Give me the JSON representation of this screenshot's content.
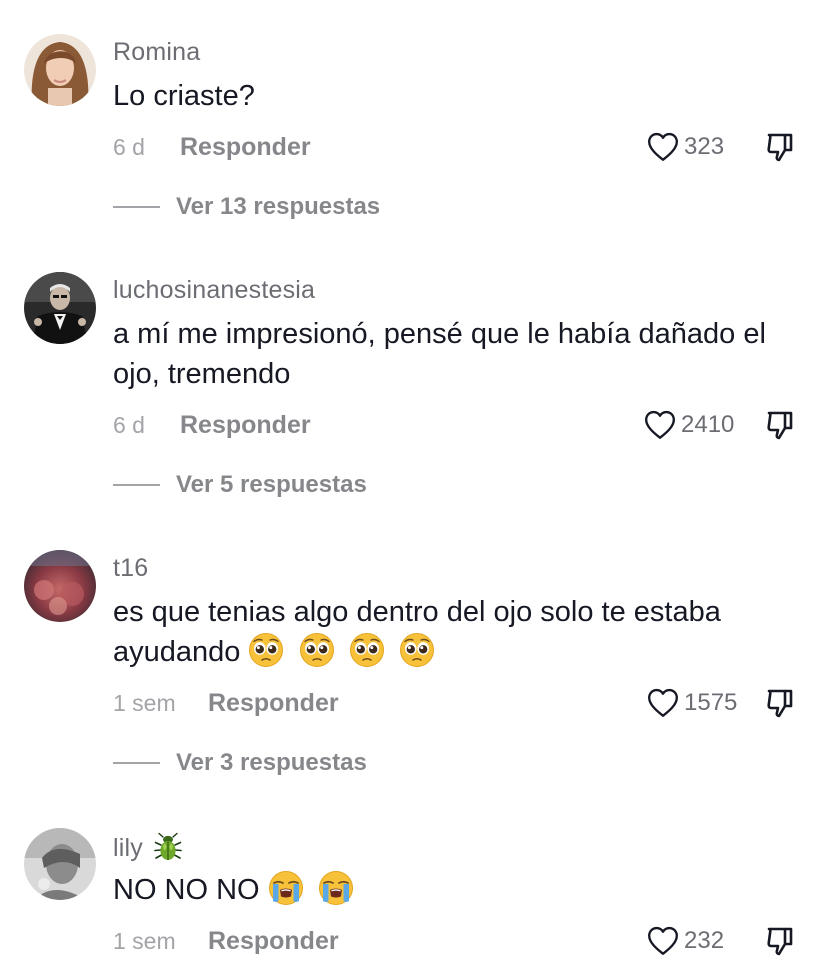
{
  "comments": [
    {
      "username": "Romina",
      "text": "Lo criaste?",
      "timestamp": "6 d",
      "reply_label": "Responder",
      "likes": "323",
      "replies_label": "Ver 13 respuestas"
    },
    {
      "username": "luchosinanestesia",
      "text": "a mí me impresionó, pensé que le había dañado el ojo, tremendo",
      "timestamp": "6 d",
      "reply_label": "Responder",
      "likes": "2410",
      "replies_label": "Ver 5 respuestas"
    },
    {
      "username": "t16",
      "text": "es que tenias algo dentro del ojo solo te estaba ayudando",
      "emojis": [
        "pleading-face",
        "pleading-face",
        "pleading-face",
        "pleading-face"
      ],
      "timestamp": "1 sem",
      "reply_label": "Responder",
      "likes": "1575",
      "replies_label": "Ver 3 respuestas"
    },
    {
      "username": "lily",
      "username_emoji": "beetle",
      "text": "NO NO NO",
      "emojis": [
        "loudly-crying-face",
        "loudly-crying-face"
      ],
      "timestamp": "1 sem",
      "reply_label": "Responder",
      "likes": "232"
    }
  ],
  "icons": {
    "like": "heart-outline-icon",
    "dislike": "thumbs-down-icon"
  },
  "colors": {
    "text": "#161823",
    "secondary": "#86878b",
    "username": "#6b6d73",
    "timestamp": "#a3a4a8",
    "background": "#ffffff"
  }
}
